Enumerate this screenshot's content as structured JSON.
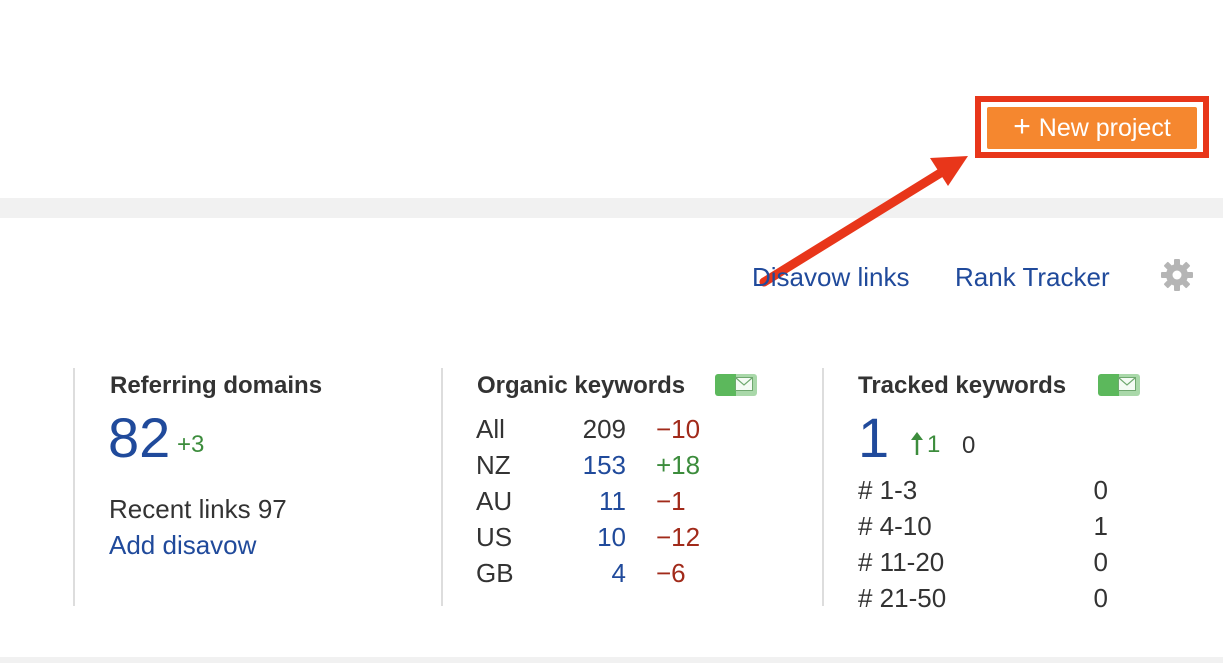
{
  "header": {
    "new_project_label": "New project",
    "new_project_icon": "plus-icon",
    "highlight_color": "#e8361a",
    "button_color": "#f5872f"
  },
  "toolbar": {
    "disavow_links_label": "Disavow links",
    "rank_tracker_label": "Rank Tracker",
    "settings_icon": "gear-icon"
  },
  "referring_domains": {
    "title": "Referring domains",
    "value": "82",
    "delta": "+3",
    "recent_links_label": "Recent links 97",
    "add_disavow_label": "Add disavow"
  },
  "organic_keywords": {
    "title": "Organic keywords",
    "badge_icon": "mail-icon",
    "rows": [
      {
        "country": "All",
        "count": "209",
        "delta": "−10"
      },
      {
        "country": "NZ",
        "count": "153",
        "delta": "+18"
      },
      {
        "country": "AU",
        "count": "11",
        "delta": "−1"
      },
      {
        "country": "US",
        "count": "10",
        "delta": "−12"
      },
      {
        "country": "GB",
        "count": "4",
        "delta": "−6"
      }
    ]
  },
  "tracked_keywords": {
    "title": "Tracked keywords",
    "badge_icon": "mail-icon",
    "value": "1",
    "up_count": "1",
    "down_count": "0",
    "ranges": [
      {
        "label": "# 1-3",
        "value": "0"
      },
      {
        "label": "# 4-10",
        "value": "1"
      },
      {
        "label": "# 11-20",
        "value": "0"
      },
      {
        "label": "# 21-50",
        "value": "0"
      }
    ]
  }
}
